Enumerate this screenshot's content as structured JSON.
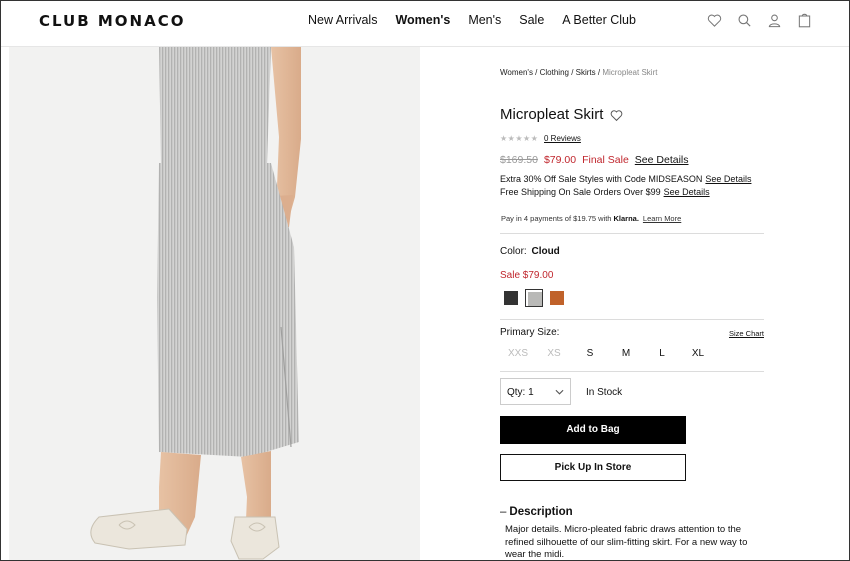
{
  "header": {
    "logo": "CLUB MONACO",
    "nav": [
      "New Arrivals",
      "Women's",
      "Men's",
      "Sale",
      "A Better Club"
    ],
    "active_nav": "Women's",
    "icons": [
      "heart-icon",
      "search-icon",
      "user-icon",
      "bag-icon"
    ]
  },
  "breadcrumb": {
    "items": [
      "Women's",
      "Clothing",
      "Skirts"
    ],
    "current": "Micropleat Skirt",
    "separator": " / "
  },
  "product": {
    "title": "Micropleat Skirt",
    "stars": "★★★★★",
    "reviews": "0 Reviews",
    "original_price": "$169.50",
    "sale_price": "$79.00",
    "final_sale": "Final Sale",
    "see_details": "See Details"
  },
  "promos": [
    {
      "text": "Extra 30% Off Sale Styles with Code MIDSEASON",
      "link": "See Details"
    },
    {
      "text": "Free Shipping On Sale Orders Over $99",
      "link": "See Details"
    }
  ],
  "klarna": {
    "text": "Pay in 4 payments of $19.75 with",
    "brand": "Klarna.",
    "link": "Learn More"
  },
  "color": {
    "label": "Color:",
    "value": "Cloud",
    "sale_label": "Sale $79.00",
    "swatches": [
      {
        "name": "charcoal",
        "hex": "#333333",
        "selected": false
      },
      {
        "name": "cloud",
        "hex": "#b9b9b7",
        "selected": true
      },
      {
        "name": "rust",
        "hex": "#c0622a",
        "selected": false
      }
    ]
  },
  "size": {
    "label": "Primary Size:",
    "chart_link": "Size Chart",
    "options": [
      {
        "label": "XXS",
        "available": false
      },
      {
        "label": "XS",
        "available": false
      },
      {
        "label": "S",
        "available": true
      },
      {
        "label": "M",
        "available": true
      },
      {
        "label": "L",
        "available": true
      },
      {
        "label": "XL",
        "available": true
      }
    ]
  },
  "purchase": {
    "qty_label": "Qty: 1",
    "stock": "In Stock",
    "add_to_bag": "Add to Bag",
    "pickup": "Pick Up In Store"
  },
  "description": {
    "toggle": "–",
    "heading": "Description",
    "body": "Major details. Micro-pleated fabric draws attention to the refined silhouette of our slim-fitting skirt. For a new way to wear the midi."
  }
}
